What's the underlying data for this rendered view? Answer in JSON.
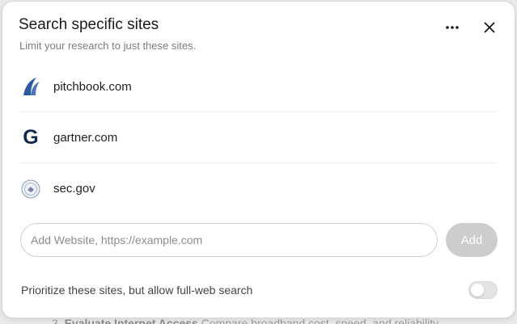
{
  "backdrop": {
    "number": "3.",
    "heading": "Evaluate Internet Access",
    "text": "Compare broadband cost, speed, and reliability"
  },
  "dialog": {
    "title": "Search specific sites",
    "subtitle": "Limit your research to just these sites.",
    "more_icon": "more-horizontal-icon",
    "close_icon": "close-icon"
  },
  "sites": [
    {
      "name": "pitchbook.com",
      "icon": "pitchbook-logo"
    },
    {
      "name": "gartner.com",
      "icon": "gartner-logo",
      "glyph": "G"
    },
    {
      "name": "sec.gov",
      "icon": "sec-seal-logo"
    }
  ],
  "add_site": {
    "placeholder": "Add Website, https://example.com",
    "value": "",
    "button_label": "Add"
  },
  "prioritize": {
    "label": "Prioritize these sites, but allow full-web search",
    "enabled": false
  },
  "colors": {
    "gartner_navy": "#13294b",
    "pitchbook_blue": "#2c5aa0",
    "add_button_disabled": "#cdcdcd"
  }
}
